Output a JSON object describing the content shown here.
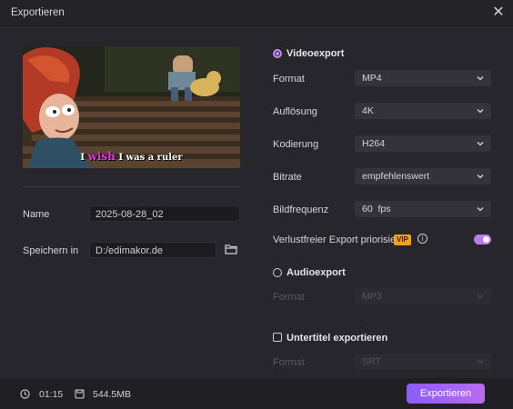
{
  "dialog": {
    "title": "Exportieren"
  },
  "preview": {
    "subtitle_pre": "I ",
    "subtitle_highlight": "wish",
    "subtitle_post": " I was a ruler"
  },
  "left": {
    "name_label": "Name",
    "name_value": "2025-08-28_02",
    "save_label": "Speichern in",
    "save_value": "D:/edimakor.de"
  },
  "video_export": {
    "label": "Videoexport",
    "selected": true,
    "rows": [
      {
        "label": "Format",
        "value": "MP4"
      },
      {
        "label": "Auflösung",
        "value": "4K"
      },
      {
        "label": "Kodierung",
        "value": "H264"
      },
      {
        "label": "Bitrate",
        "value": "empfehlenswert"
      },
      {
        "label": "Bildfrequenz",
        "value": "60  fps"
      }
    ],
    "lossless_label": "Verlustfreier Export priorisiert",
    "vip_badge": "VIP",
    "lossless_enabled": true
  },
  "audio_export": {
    "label": "Audioexport",
    "selected": false,
    "format_label": "Format",
    "format_value": "MP3"
  },
  "subtitle_export": {
    "label": "Untertitel exportieren",
    "checked": false,
    "format_label": "Format",
    "format_value": "SRT"
  },
  "footer": {
    "duration": "01:15",
    "size": "544.5MB",
    "export_button": "Exportieren"
  },
  "colors": {
    "accent": "#b87cf2",
    "vip": "#f0a21f",
    "button_start": "#8b5cf6",
    "button_end": "#b86cf0"
  }
}
